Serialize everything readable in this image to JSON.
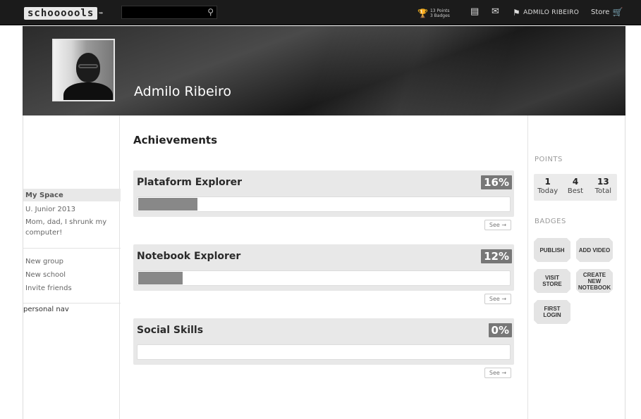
{
  "topbar": {
    "logo_text": "schoooools",
    "logo_arrow": "➥",
    "search_placeholder": "",
    "search_icon": "search-icon",
    "points_line": "13 Points",
    "badges_line": "3 Badges",
    "user_name": "ADMILO RIBEIRO",
    "store_label": "Store"
  },
  "profile": {
    "name": "Admilo Ribeiro"
  },
  "left_nav": {
    "header": "My Space",
    "items": [
      "U. Junior 2013",
      "Mom, dad, I shrunk my computer!"
    ],
    "actions": [
      "New group",
      "New school",
      "Invite friends"
    ],
    "footer": "personal nav"
  },
  "main": {
    "heading": "Achievements",
    "achievements": [
      {
        "title": "Plataform Explorer",
        "percent_label": "16%",
        "progress": 0.16,
        "see_label": "See →"
      },
      {
        "title": "Notebook Explorer",
        "percent_label": "12%",
        "progress": 0.12,
        "see_label": "See →"
      },
      {
        "title": "Social Skills",
        "percent_label": "0%",
        "progress": 0.0,
        "see_label": "See →"
      }
    ]
  },
  "sidebar": {
    "points_label": "POINTS",
    "points": [
      {
        "value": "1",
        "label": "Today"
      },
      {
        "value": "4",
        "label": "Best"
      },
      {
        "value": "13",
        "label": "Total"
      }
    ],
    "badges_label": "BADGES",
    "badges": [
      "PUBLISH",
      "ADD VIDEO",
      "VISIT STORE",
      "CREATE NEW NOTEBOOK",
      "FIRST LOGIN"
    ]
  },
  "colors": {
    "topbar_bg": "#1b1b1b",
    "progress_fill": "#888888",
    "percent_badge": "#777777"
  }
}
